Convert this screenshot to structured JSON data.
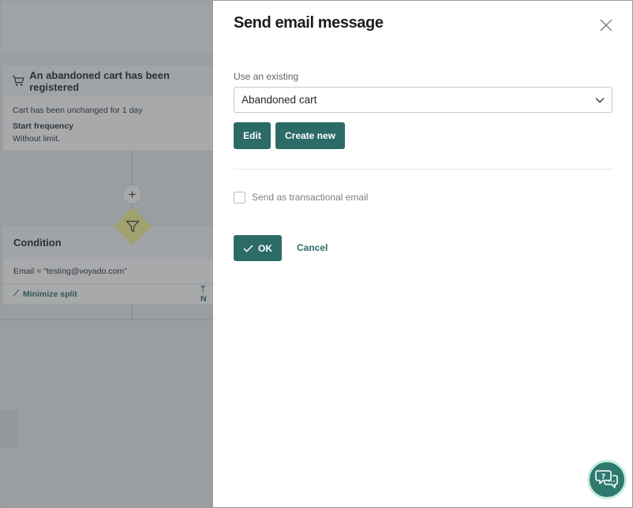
{
  "canvas": {
    "trigger": {
      "title": "An abandoned cart has been registered",
      "detail": "Cart has been unchanged for 1 day",
      "frequency_label": "Start frequency",
      "frequency_value": "Without limit."
    },
    "add_step_label": "+",
    "condition": {
      "title": "Condition",
      "rule": "Email = \"testing@voyado.com\"",
      "minimize_label": "Minimize split",
      "branch_label": "N"
    },
    "colors": {
      "condition_node": "#f4f191",
      "overlay": "rgba(60,64,68,0.45)"
    }
  },
  "drawer": {
    "title": "Send email message",
    "use_existing_label": "Use an existing",
    "selected_message": "Abandoned cart",
    "edit_label": "Edit",
    "create_new_label": "Create new",
    "transactional_label": "Send as transactional email",
    "transactional_checked": false,
    "ok_label": "OK",
    "cancel_label": "Cancel",
    "colors": {
      "primary": "#2c6b66",
      "link": "#2c6b66"
    }
  },
  "icons": {
    "close": "close-icon",
    "chevron": "chevron-down-icon",
    "cart": "cart-icon",
    "filter": "filter-icon",
    "check": "check-icon",
    "chat": "chat-icon"
  }
}
